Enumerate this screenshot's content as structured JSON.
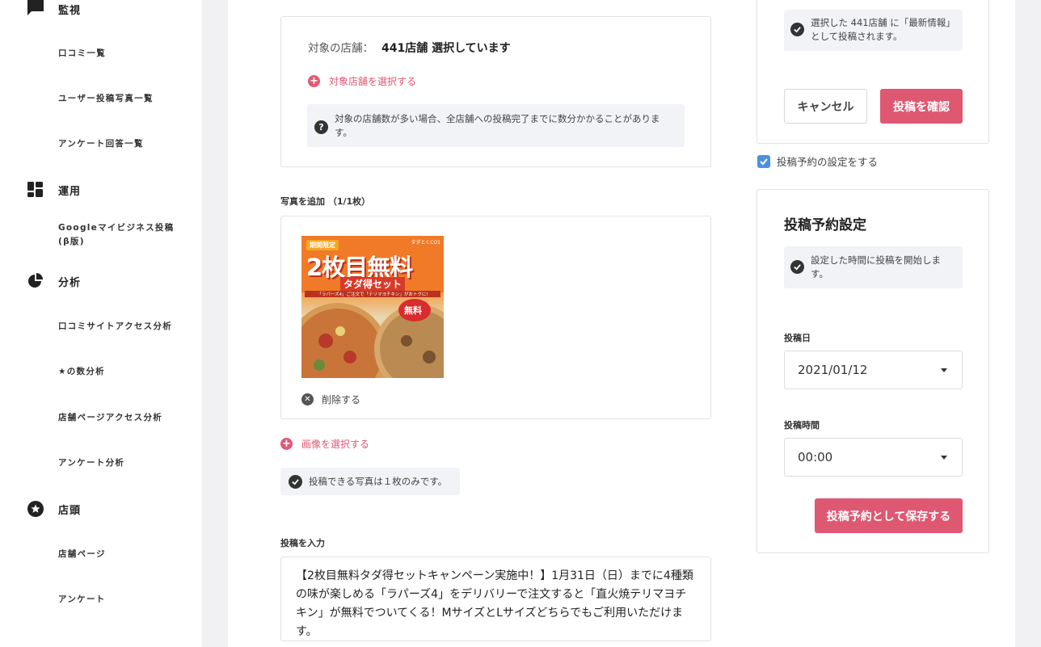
{
  "sidebar": {
    "sections": [
      {
        "label": "監視",
        "icon": "comment-icon"
      },
      {
        "label": "運用",
        "icon": "dashboard-icon"
      },
      {
        "label": "分析",
        "icon": "pie-chart-icon"
      },
      {
        "label": "店頭",
        "icon": "star-badge-icon"
      }
    ],
    "items": [
      "口コミ一覧",
      "ユーザー投稿写真一覧",
      "アンケート回答一覧",
      "Googleマイビジネス投稿\n(β版)",
      "口コミサイトアクセス分析",
      "★の数分析",
      "店舗ページアクセス分析",
      "アンケート分析",
      "店舗ページ",
      "アンケート"
    ]
  },
  "target": {
    "label": "対象の店舗：",
    "value": "441店舗 選択しています",
    "select_link": "対象店舗を選択する",
    "note": "対象の店舗数が多い場合、全店舗への投稿完了までに数分かかることがあります。"
  },
  "photo": {
    "section_label": "写真を追加 （1/1枚）",
    "delete_label": "削除する",
    "select_link": "画像を選択する",
    "note": "投稿できる写真は１枚のみです。",
    "image": {
      "badge": "期間限定",
      "corner": "タダとくCO1",
      "headline": "2枚目無料",
      "subhead": "タダ得セット",
      "caption": "「ラパーズ4」ご注文で「テリマヨチキン」がおトクに!",
      "stamp": "無料"
    }
  },
  "post": {
    "section_label": "投稿を入力",
    "text": "【2枚目無料タダ得セットキャンペーン実施中！】1月31日（日）までに4種類の味が楽しめる「ラパーズ4」をデリバリーで注文すると「直火焼テリマヨチキン」が無料でついてくる！MサイズとLサイズどちらでもご利用いただけます。"
  },
  "right": {
    "confirm_note": "選択した 441店舗 に「最新情報」として投稿されます。",
    "cancel_label": "キャンセル",
    "confirm_label": "投稿を確認",
    "schedule_checkbox_label": "投稿予約の設定をする",
    "schedule_checked": true,
    "schedule": {
      "title": "投稿予約設定",
      "note": "設定した時間に投稿を開始します。",
      "date_label": "投稿日",
      "date_value": "2021/01/12",
      "time_label": "投稿時間",
      "time_value": "00:00",
      "save_label": "投稿予約として保存する"
    }
  },
  "colors": {
    "accent": "#de5872",
    "checkbox": "#4a90e2",
    "background": "#f1f1f4"
  }
}
